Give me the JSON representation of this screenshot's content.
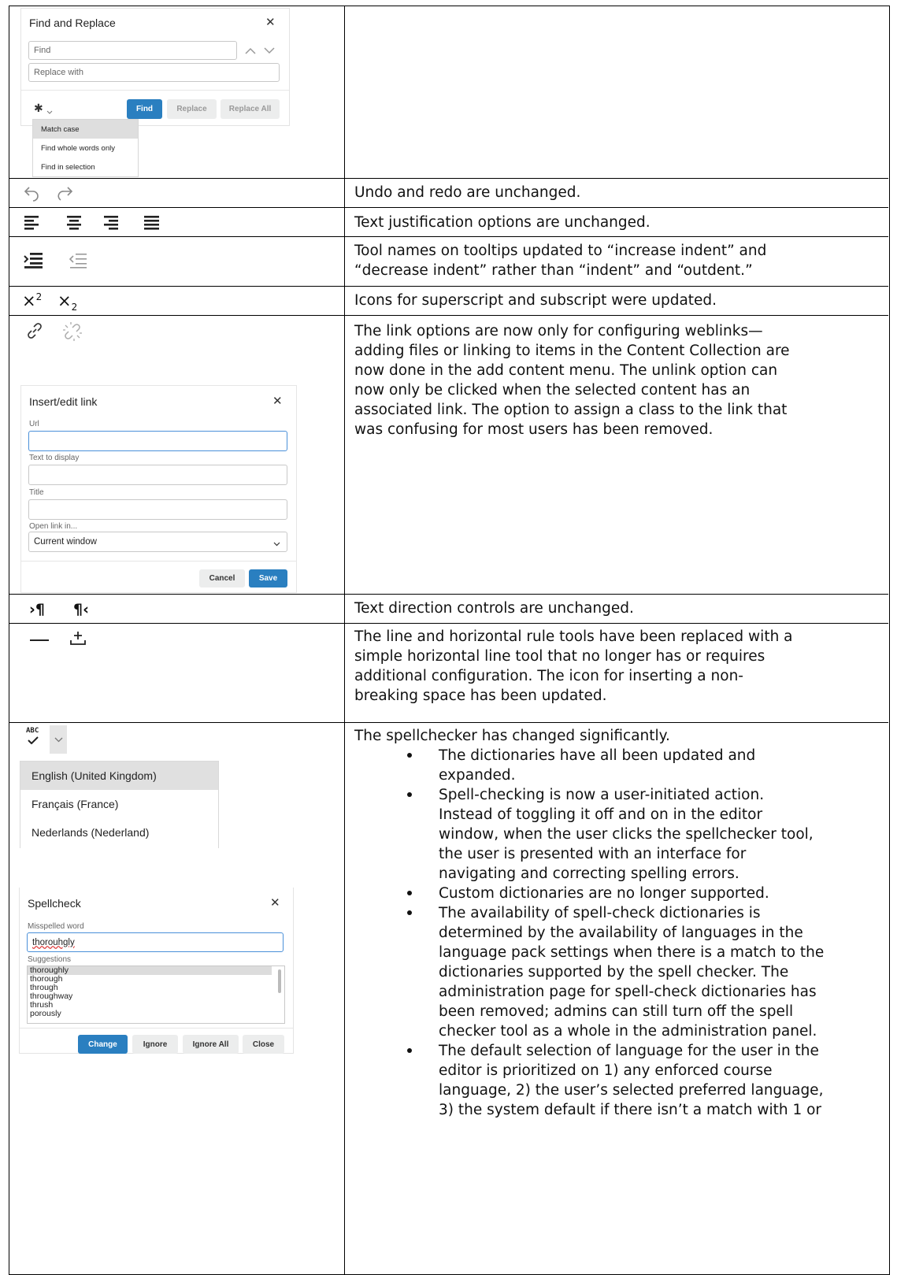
{
  "find_replace": {
    "title": "Find and Replace",
    "find_placeholder": "Find",
    "replace_placeholder": "Replace with",
    "find_btn": "Find",
    "replace_btn": "Replace",
    "replace_all_btn": "Replace All",
    "options": [
      "Match case",
      "Find whole words only",
      "Find in selection"
    ]
  },
  "rows": {
    "undo_redo": "Undo and redo are unchanged.",
    "justify": "Text justification options are unchanged.",
    "indent": [
      "Tool names on tooltips updated to “increase indent” and",
      "“decrease indent” rather than “indent” and “outdent.”"
    ],
    "superscript": "Icons for superscript and subscript were updated.",
    "links": [
      "The link options are now only for configuring weblinks—",
      "adding files or linking to items in the Content Collection are",
      "now done in the add content menu. The unlink option can",
      "now only be clicked when the selected content has an",
      "associated link. The option to assign a class to the link that",
      "was confusing for most users has been removed."
    ],
    "direction": "Text direction controls are unchanged.",
    "hr": [
      "The line and horizontal rule tools have been replaced with a",
      "simple horizontal line tool that no longer has or requires",
      "additional configuration. The icon for inserting a non-",
      "breaking space has been updated."
    ],
    "spell_intro": "The spellchecker has changed significantly.",
    "spell_bullets": [
      [
        "The dictionaries have all been updated and",
        "expanded."
      ],
      [
        "Spell-checking is now a user-initiated action.",
        "Instead of toggling it off and on in the editor",
        "window, when the user clicks the spellchecker tool,",
        "the user is presented with an interface for",
        "navigating and correcting spelling errors."
      ],
      [
        "Custom dictionaries are no longer supported."
      ],
      [
        "The availability of spell-check dictionaries is",
        "determined by the availability of languages in the",
        "language pack settings when there is a match to the",
        "dictionaries supported by the spell checker. The",
        "administration page for spell-check dictionaries has",
        "been removed; admins can still turn off the spell",
        "checker tool as a whole in the administration panel."
      ],
      [
        "The default selection of language for the user in the",
        "editor is prioritized on 1) any enforced course",
        "language, 2) the user’s selected preferred language,",
        "3) the system default if there isn’t a match with 1 or"
      ]
    ]
  },
  "link_dialog": {
    "title": "Insert/edit link",
    "url_label": "Url",
    "text_label": "Text to display",
    "title_label": "Title",
    "open_label": "Open link in...",
    "open_value": "Current window",
    "cancel": "Cancel",
    "save": "Save"
  },
  "spell_toolbar": {
    "abc": "ABC",
    "languages": [
      "English (United Kingdom)",
      "Français (France)",
      "Nederlands (Nederland)"
    ]
  },
  "spellcheck_dialog": {
    "title": "Spellcheck",
    "misspelled_label": "Misspelled word",
    "misspelled_value": "thorouhgly",
    "suggestions_label": "Suggestions",
    "suggestions": [
      "thoroughly",
      "thorough",
      "through",
      "throughway",
      "thrush",
      "porously"
    ],
    "change": "Change",
    "ignore": "Ignore",
    "ignore_all": "Ignore All",
    "close": "Close"
  }
}
